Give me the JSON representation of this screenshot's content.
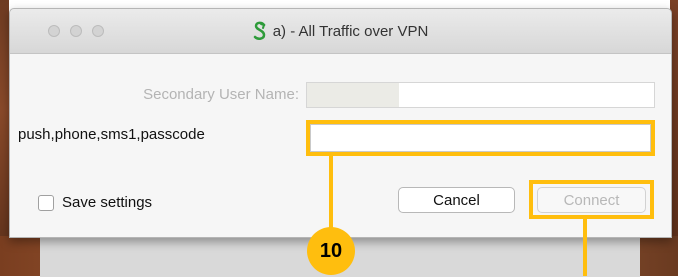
{
  "window": {
    "title": "a) - All Traffic over VPN",
    "app_icon": "cisco-anyconnect-icon"
  },
  "form": {
    "secondary_label": "Secondary User Name:",
    "secondary_value": "",
    "push_label": "push,phone,sms1,passcode",
    "push_value": "",
    "save_settings_label": "Save settings",
    "save_settings_checked": false
  },
  "buttons": {
    "cancel": "Cancel",
    "connect": "Connect"
  },
  "annotation": {
    "step_number": "10",
    "highlight_color": "#ffbe0e"
  }
}
